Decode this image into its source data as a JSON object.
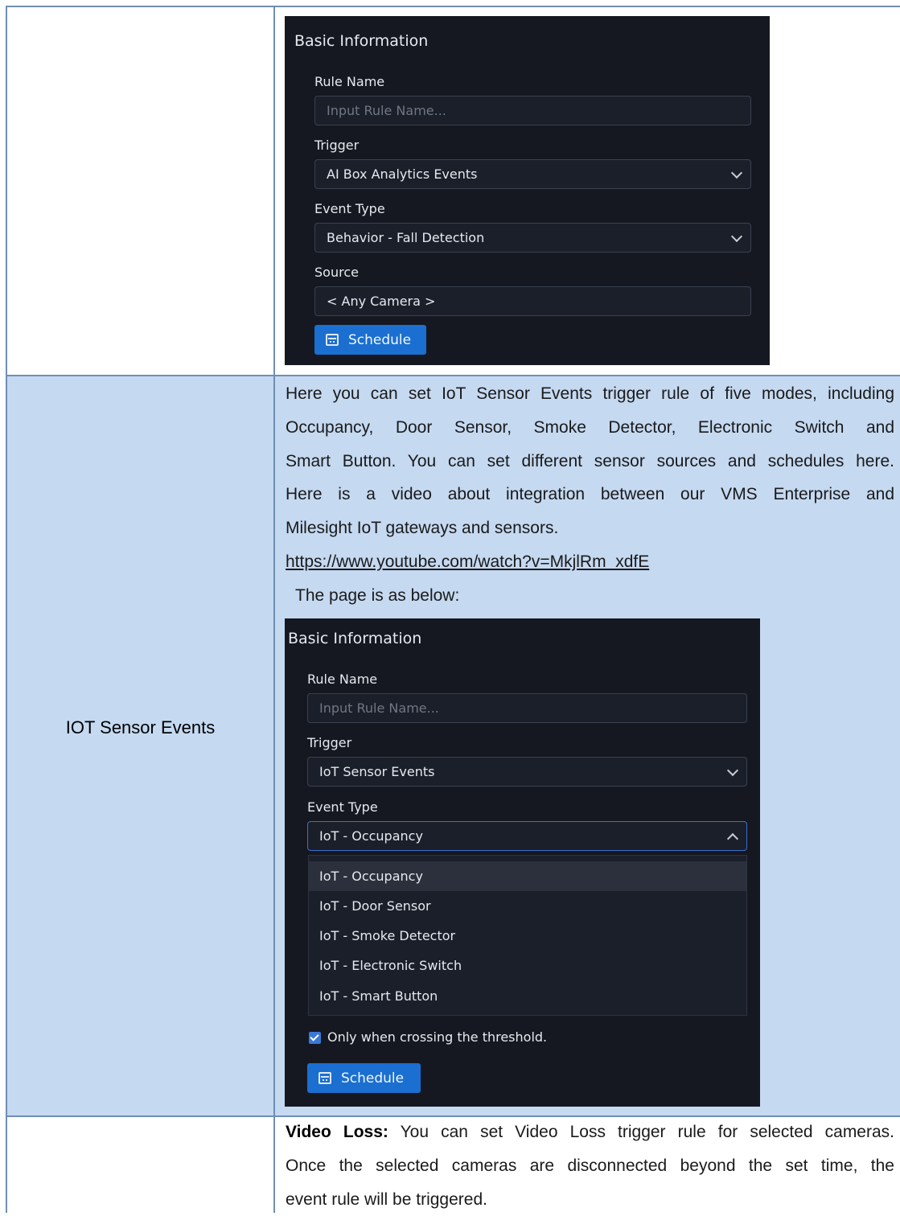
{
  "panel1": {
    "title": "Basic Information",
    "rule_name_label": "Rule Name",
    "rule_name_placeholder": "Input Rule Name...",
    "trigger_label": "Trigger",
    "trigger_value": "AI Box Analytics Events",
    "event_type_label": "Event Type",
    "event_type_value": "Behavior - Fall Detection",
    "source_label": "Source",
    "source_value": "< Any Camera >",
    "schedule_button": "Schedule"
  },
  "row2": {
    "label": "IOT Sensor Events",
    "lines": [
      "Here you can set IoT Sensor Events trigger rule of five modes, including",
      "Occupancy, Door Sensor, Smoke Detector, Electronic Switch and",
      "Smart Button. You can set different sensor sources and schedules here.",
      "Here is a video about integration between our VMS Enterprise and",
      "Milesight IoT gateways and sensors."
    ],
    "link": "https://www.youtube.com/watch?v=MkjlRm_xdfE",
    "page_note": "The page is as below:"
  },
  "panel2": {
    "title": "Basic Information",
    "rule_name_label": "Rule Name",
    "rule_name_placeholder": "Input Rule Name...",
    "trigger_label": "Trigger",
    "trigger_value": "IoT Sensor Events",
    "event_type_label": "Event Type",
    "event_type_value": "IoT - Occupancy",
    "options": [
      "IoT - Occupancy",
      "IoT - Door Sensor",
      "IoT - Smoke Detector",
      "IoT - Electronic Switch",
      "IoT - Smart Button"
    ],
    "threshold_label": "Only when crossing the threshold.",
    "threshold_checked": true,
    "schedule_button": "Schedule"
  },
  "row3": {
    "keyword": "Video Loss:",
    "line1_rest": " You can set Video Loss trigger rule for selected cameras.",
    "line2": "Once the selected cameras are disconnected beyond the set time, the",
    "line3": "event rule will be triggered."
  }
}
